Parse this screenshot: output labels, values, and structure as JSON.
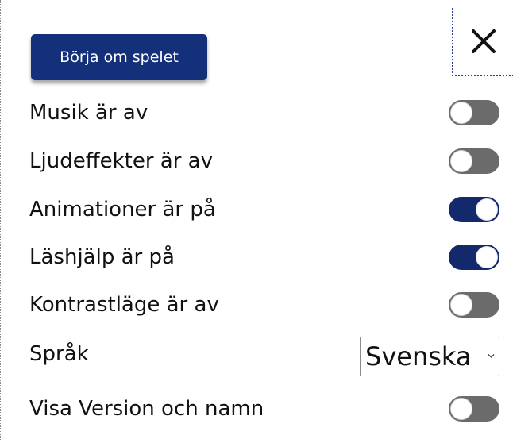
{
  "settings": {
    "restart_label": "Börja om spelet",
    "close_icon": "close-icon",
    "rows": [
      {
        "label": "Musik är av",
        "toggle_on": false
      },
      {
        "label": "Ljudeffekter är av",
        "toggle_on": false
      },
      {
        "label": "Animationer är på",
        "toggle_on": true
      },
      {
        "label": "Läshjälp är på",
        "toggle_on": true
      },
      {
        "label": "Kontrastläge är av",
        "toggle_on": false
      }
    ],
    "language": {
      "label": "Språk",
      "selected": "Svenska"
    },
    "version_row": {
      "label": "Visa Version och namn",
      "toggle_on": false
    }
  },
  "colors": {
    "accent": "#15307a",
    "toggle_on": "#13296b",
    "toggle_off": "#6b6b6b"
  }
}
